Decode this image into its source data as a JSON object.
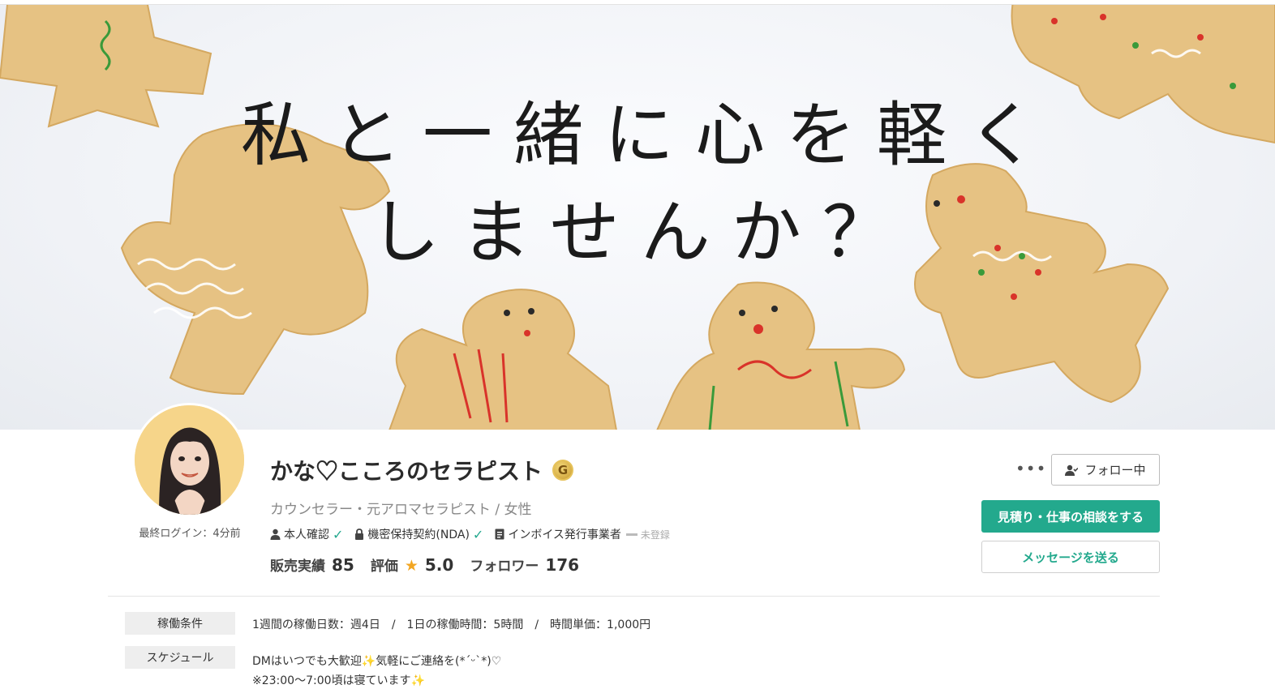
{
  "cover": {
    "line1": "私と一緒に心を軽く",
    "line2": "しませんか？"
  },
  "profile": {
    "name": "かな♡こころのセラピスト",
    "rank_badge": "G",
    "title": "カウンセラー・元アロマセラピスト / 女性",
    "last_login": "最終ログイン：4分前"
  },
  "verifications": {
    "identity": "本人確認",
    "nda": "機密保持契約(NDA)",
    "invoice": "インボイス発行事業者",
    "invoice_status": "未登録",
    "check_glyph": "✓"
  },
  "stats": {
    "sales_label": "販売実績",
    "sales_value": "85",
    "rating_label": "評価",
    "rating_value": "5.0",
    "followers_label": "フォロワー",
    "followers_value": "176"
  },
  "actions": {
    "more": "•••",
    "follow": "フォロー中",
    "quote": "見積り・仕事の相談をする",
    "message": "メッセージを送る"
  },
  "details": {
    "work_label": "稼働条件",
    "work_text": "1週間の稼働日数：週4日　/　1日の稼働時間：5時間　/　時間単価：1,000円",
    "schedule_label": "スケジュール",
    "schedule_line1": "DMはいつでも大歓迎",
    "schedule_line1b": "気軽にご連絡を(*ˊᵕˋ*)♡",
    "schedule_line2": "※23:00〜7:00頃は寝ています",
    "sparkle": "✨"
  },
  "icons": [
    "person-icon",
    "lock-icon",
    "document-icon",
    "check-icon",
    "star-icon",
    "follow-person-icon",
    "more-icon",
    "sparkle-icon"
  ],
  "colors": {
    "accent": "#23a98d",
    "star": "#f2a623",
    "badge_gold": "#c99a2e"
  }
}
